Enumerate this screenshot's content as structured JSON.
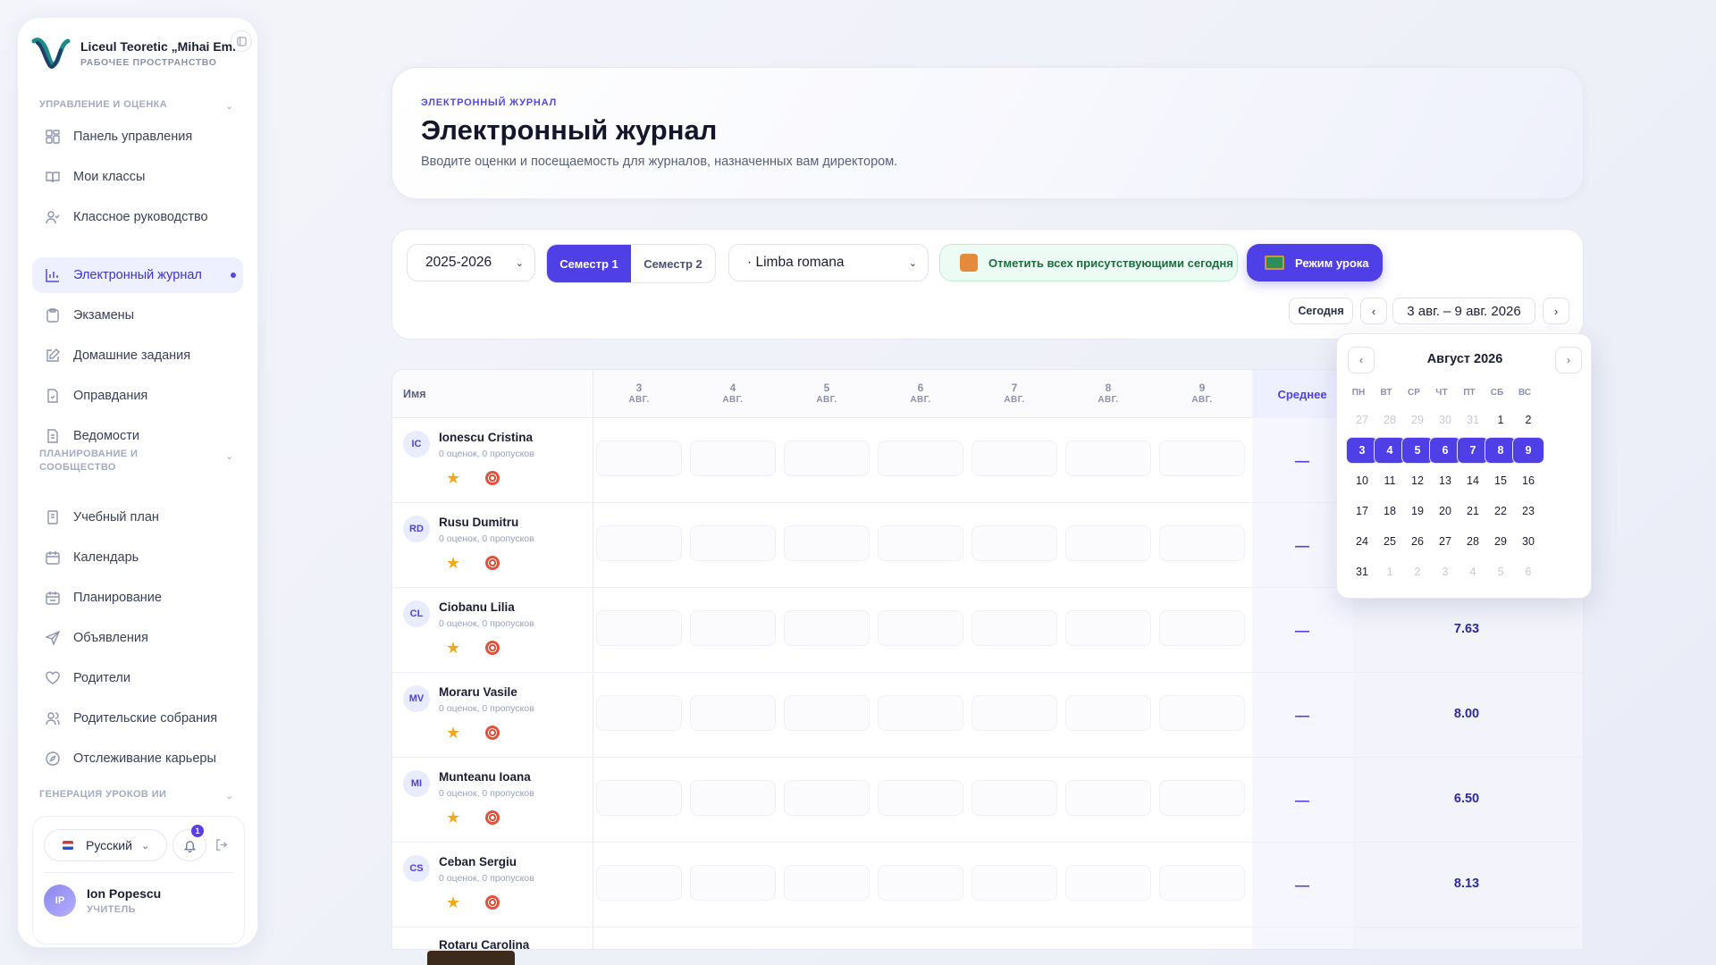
{
  "brand": {
    "name": "Liceul Teoretic „Mihai Emi...",
    "sub": "РАБОЧЕЕ ПРОСТРАНСТВО"
  },
  "sidebar": {
    "sections": [
      {
        "title": "УПРАВЛЕНИЕ И ОЦЕНКА"
      },
      {
        "title": "ПЛАНИРОВАНИЕ И СООБЩЕСТВО"
      },
      {
        "title": "ГЕНЕРАЦИЯ УРОКОВ ИИ"
      }
    ],
    "items": [
      {
        "label": "Панель управления",
        "icon": "dashboard-icon"
      },
      {
        "label": "Мои классы",
        "icon": "book-icon"
      },
      {
        "label": "Классное руководство",
        "icon": "user-check-icon"
      },
      {
        "label": "Электронный журнал",
        "icon": "bar-chart-icon",
        "active": true
      },
      {
        "label": "Экзамены",
        "icon": "clipboard-icon"
      },
      {
        "label": "Домашние задания",
        "icon": "edit-icon"
      },
      {
        "label": "Оправдания",
        "icon": "file-check-icon"
      },
      {
        "label": "Ведомости",
        "icon": "file-text-icon"
      },
      {
        "label": "Учебный план",
        "icon": "book-open-icon"
      },
      {
        "label": "Календарь",
        "icon": "calendar-icon"
      },
      {
        "label": "Планирование",
        "icon": "calendar-check-icon"
      },
      {
        "label": "Объявления",
        "icon": "send-icon"
      },
      {
        "label": "Родители",
        "icon": "heart-icon"
      },
      {
        "label": "Родительские собрания",
        "icon": "users-icon"
      },
      {
        "label": "Отслеживание карьеры",
        "icon": "compass-icon"
      }
    ],
    "footer": {
      "language": "Русский",
      "notifications": "1",
      "user_name": "Ion Popescu",
      "user_initials": "IP",
      "user_role": "УЧИТЕЛЬ"
    }
  },
  "header": {
    "eyebrow": "ЭЛЕКТРОННЫЙ ЖУРНАЛ",
    "title": "Электронный журнал",
    "subtitle": "Вводите оценки и посещаемость для журналов, назначенных вам директором."
  },
  "controls": {
    "year": "2025-2026",
    "semester1": "Семестр 1",
    "semester2": "Семестр 2",
    "subject": "· Limba romana",
    "mark_all": "Отметить всех присутствующими сегодня",
    "lesson_mode": "Режим урока",
    "today": "Сегодня",
    "range": "3 авг. – 9 авг. 2026"
  },
  "table": {
    "name_header": "Имя",
    "avg_header": "Среднее",
    "days": [
      {
        "num": "3",
        "mon": "АВГ."
      },
      {
        "num": "4",
        "mon": "АВГ."
      },
      {
        "num": "5",
        "mon": "АВГ."
      },
      {
        "num": "6",
        "mon": "АВГ."
      },
      {
        "num": "7",
        "mon": "АВГ."
      },
      {
        "num": "8",
        "mon": "АВГ."
      },
      {
        "num": "9",
        "mon": "АВГ."
      }
    ],
    "students": [
      {
        "initials": "IC",
        "name": "Ionescu Cristina",
        "meta": "0 оценок, 0 пропусков",
        "avg": "—",
        "grade": ""
      },
      {
        "initials": "RD",
        "name": "Rusu Dumitru",
        "meta": "0 оценок, 0 пропусков",
        "avg": "—",
        "grade": ""
      },
      {
        "initials": "CL",
        "name": "Ciobanu Lilia",
        "meta": "0 оценок, 0 пропусков",
        "avg": "—",
        "grade": "7.63"
      },
      {
        "initials": "MV",
        "name": "Moraru Vasile",
        "meta": "0 оценок, 0 пропусков",
        "avg": "—",
        "grade": "8.00"
      },
      {
        "initials": "MI",
        "name": "Munteanu Ioana",
        "meta": "0 оценок, 0 пропусков",
        "avg": "—",
        "grade": "6.50"
      },
      {
        "initials": "CS",
        "name": "Ceban Sergiu",
        "meta": "0 оценок, 0 пропусков",
        "avg": "—",
        "grade": "8.13"
      },
      {
        "initials": "",
        "name": "Rotaru Carolina",
        "meta": "",
        "avg": "",
        "grade": ""
      }
    ]
  },
  "calendar": {
    "title": "Август 2026",
    "dow": [
      "ПН",
      "ВТ",
      "СР",
      "ЧТ",
      "ПТ",
      "СБ",
      "ВС"
    ],
    "weeks": [
      [
        "27",
        "28",
        "29",
        "30",
        "31",
        "1",
        "2"
      ],
      [
        "3",
        "4",
        "5",
        "6",
        "7",
        "8",
        "9"
      ],
      [
        "10",
        "11",
        "12",
        "13",
        "14",
        "15",
        "16"
      ],
      [
        "17",
        "18",
        "19",
        "20",
        "21",
        "22",
        "23"
      ],
      [
        "24",
        "25",
        "26",
        "27",
        "28",
        "29",
        "30"
      ],
      [
        "31",
        "1",
        "2",
        "3",
        "4",
        "5",
        "6"
      ]
    ],
    "muted_first_row_count": 5,
    "muted_last_row_from": 1,
    "selected_row": 1
  },
  "colors": {
    "accent": "#4f3fe6",
    "success_bg": "#ecfbf3",
    "success_text": "#1f6b41"
  }
}
